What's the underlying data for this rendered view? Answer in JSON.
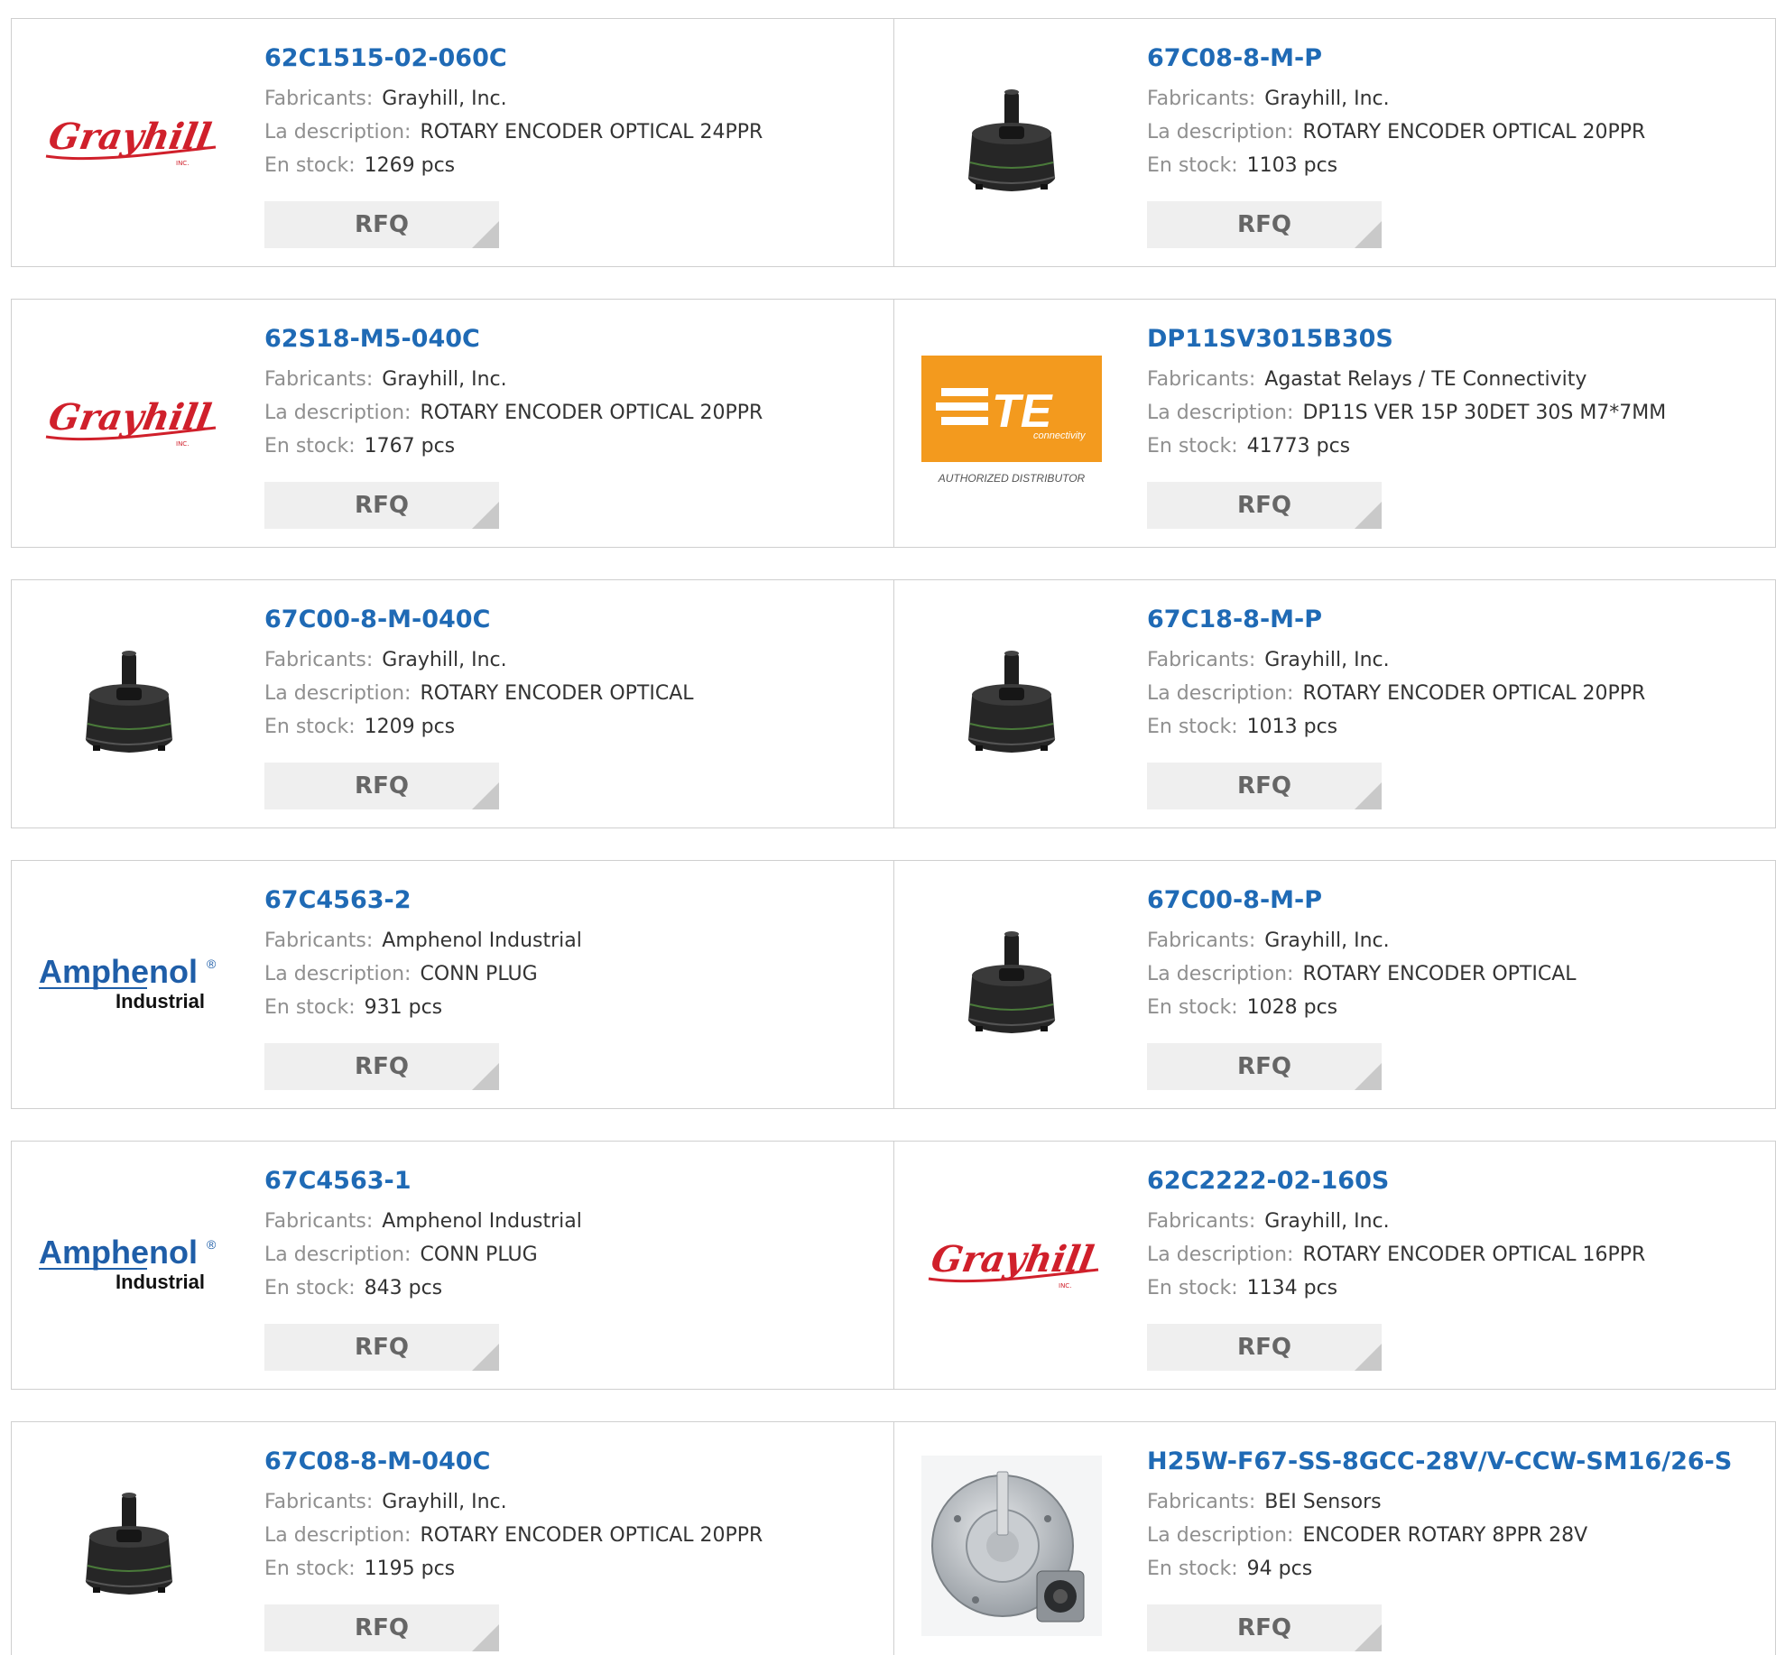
{
  "labels": {
    "manufacturer": "Fabricants:",
    "description": "La description:",
    "stock": "En stock:",
    "rfq": "RFQ"
  },
  "colors": {
    "part_link": "#1f6ab5",
    "grayhill_red": "#d0202b",
    "amphenol_blue": "#1f5ea8",
    "te_orange": "#f39a1e"
  },
  "brands": {
    "grayhill": "Grayhill",
    "grayhill_inc": "INC.",
    "amphenol": "Amphenol",
    "amphenol_reg": "®",
    "amphenol_sub": "Industrial",
    "te": "TE",
    "te_sub": "connectivity",
    "te_dist": "AUTHORIZED DISTRIBUTOR"
  },
  "products": [
    {
      "part": "62C1515-02-060C",
      "manufacturer": "Grayhill, Inc.",
      "description": "ROTARY ENCODER OPTICAL 24PPR",
      "stock": "1269 pcs",
      "image": "grayhill-logo"
    },
    {
      "part": "67C08-8-M-P",
      "manufacturer": "Grayhill, Inc.",
      "description": "ROTARY ENCODER OPTICAL 20PPR",
      "stock": "1103 pcs",
      "image": "encoder-photo"
    },
    {
      "part": "62S18-M5-040C",
      "manufacturer": "Grayhill, Inc.",
      "description": "ROTARY ENCODER OPTICAL 20PPR",
      "stock": "1767 pcs",
      "image": "grayhill-logo"
    },
    {
      "part": "DP11SV3015B30S",
      "manufacturer": "Agastat Relays / TE Connectivity",
      "description": "DP11S VER 15P 30DET 30S M7*7MM",
      "stock": "41773 pcs",
      "image": "te-logo"
    },
    {
      "part": "67C00-8-M-040C",
      "manufacturer": "Grayhill, Inc.",
      "description": "ROTARY ENCODER OPTICAL",
      "stock": "1209 pcs",
      "image": "encoder-photo"
    },
    {
      "part": "67C18-8-M-P",
      "manufacturer": "Grayhill, Inc.",
      "description": "ROTARY ENCODER OPTICAL 20PPR",
      "stock": "1013 pcs",
      "image": "encoder-photo"
    },
    {
      "part": "67C4563-2",
      "manufacturer": "Amphenol Industrial",
      "description": "CONN PLUG",
      "stock": "931 pcs",
      "image": "amphenol-logo"
    },
    {
      "part": "67C00-8-M-P",
      "manufacturer": "Grayhill, Inc.",
      "description": "ROTARY ENCODER OPTICAL",
      "stock": "1028 pcs",
      "image": "encoder-photo"
    },
    {
      "part": "67C4563-1",
      "manufacturer": "Amphenol Industrial",
      "description": "CONN PLUG",
      "stock": "843 pcs",
      "image": "amphenol-logo"
    },
    {
      "part": "62C2222-02-160S",
      "manufacturer": "Grayhill, Inc.",
      "description": "ROTARY ENCODER OPTICAL 16PPR",
      "stock": "1134 pcs",
      "image": "grayhill-logo"
    },
    {
      "part": "67C08-8-M-040C",
      "manufacturer": "Grayhill, Inc.",
      "description": "ROTARY ENCODER OPTICAL 20PPR",
      "stock": "1195 pcs",
      "image": "encoder-photo"
    },
    {
      "part": "H25W-F67-SS-8GCC-28V/V-CCW-SM16/26-S",
      "manufacturer": "BEI Sensors",
      "description": "ENCODER ROTARY 8PPR 28V",
      "stock": "94 pcs",
      "image": "bei-encoder-photo"
    }
  ]
}
